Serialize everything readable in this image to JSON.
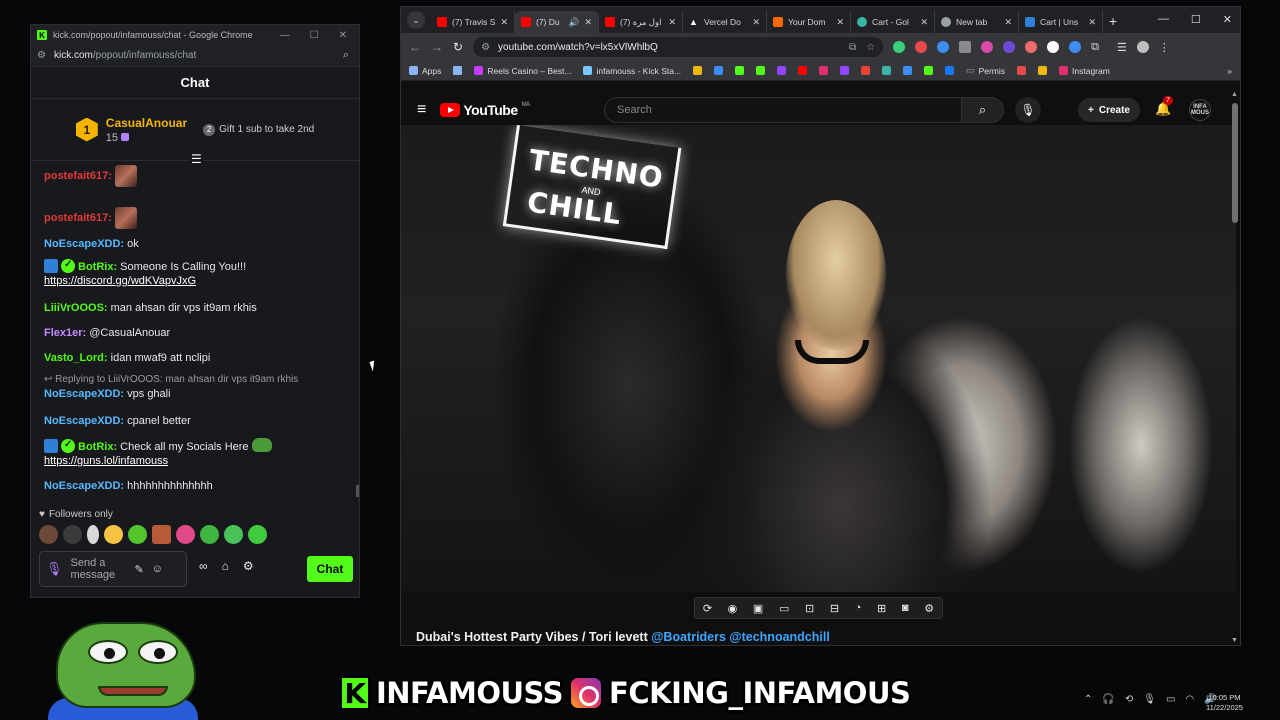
{
  "kick_window": {
    "title": "kick.com/popout/infamouss/chat - Google Chrome",
    "url_host": "kick.com",
    "url_path": "/popout/infamouss/chat",
    "chat_title": "Chat",
    "gift": {
      "rank": "1",
      "user": "CasualAnouar",
      "count": "15",
      "cta_rank": "2",
      "cta": "Gift 1 sub to take 2nd"
    },
    "messages": [
      {
        "user": "postefait617:",
        "color": "#e03a3a",
        "text": ""
      },
      {
        "user": "postefait617:",
        "color": "#e03a3a",
        "text": ""
      },
      {
        "user": "NoEscapeXDD:",
        "color": "#58b8ff",
        "text": "ok"
      },
      {
        "user": "BotRix:",
        "color": "#53fc18",
        "text": "Someone Is Calling You!!!",
        "link": "https://discord.gg/wdKVapvJxG"
      },
      {
        "user": "LiiiVrOOOS:",
        "color": "#53fc18",
        "text": "man ahsan dir vps it9am rkhis"
      },
      {
        "user": "Flex1er:",
        "color": "#c58cff",
        "text": "@CasualAnouar"
      },
      {
        "user": "Vasto_Lord:",
        "color": "#53fc18",
        "text": "idan mwaf9 att nclipi"
      },
      {
        "user": "NoEscapeXDD:",
        "color": "#58b8ff",
        "text": "vps ghali",
        "reply": "Replying to LiiiVrOOOS: man ahsan dir vps it9am rkhis"
      },
      {
        "user": "NoEscapeXDD:",
        "color": "#58b8ff",
        "text": "cpanel better"
      },
      {
        "user": "BotRix:",
        "color": "#53fc18",
        "text": "Check all my Socials Here",
        "link": "https://guns.lol/infamouss"
      },
      {
        "user": "NoEscapeXDD:",
        "color": "#58b8ff",
        "text": "hhhhhhhhhhhhhh"
      }
    ],
    "followers_only": "Followers only",
    "send_placeholder": "Send a message",
    "send_button": "Chat"
  },
  "youtube_window": {
    "tabs": [
      {
        "title": "(7) Travis S",
        "favicon": "#ff0000",
        "active": false
      },
      {
        "title": "(7) Du",
        "favicon": "#ff0000",
        "active": true
      },
      {
        "title": "(7) اول مرة",
        "favicon": "#ff0000",
        "active": false
      },
      {
        "title": "Vercel Do",
        "favicon": "#ffffff",
        "active": false
      },
      {
        "title": "Your Dom",
        "favicon": "#ff6a00",
        "active": false
      },
      {
        "title": "Cart - Gol",
        "favicon": "#3bb4a8",
        "active": false
      },
      {
        "title": "New tab",
        "favicon": "#9aa0a6",
        "active": false
      },
      {
        "title": "Cart | Uns",
        "favicon": "#2f7fd6",
        "active": false
      }
    ],
    "url": "youtube.com/watch?v=lx5xVlWhlbQ",
    "bookmarks": [
      {
        "label": "Apps",
        "color": "#8ab4f8"
      },
      {
        "label": "",
        "color": "#8ab4f8"
      },
      {
        "label": "Reels Casino – Best...",
        "color": "#c83cff"
      },
      {
        "label": "infamouss - Kick Sta...",
        "color": "#7ac7ff"
      },
      {
        "label": "Permis",
        "color": "#9aa0a6"
      },
      {
        "label": "Instagram",
        "color": "#e1306c"
      }
    ],
    "yt": {
      "logo": "YouTube",
      "region": "MA",
      "search_placeholder": "Search",
      "create_label": "Create",
      "notif_count": "7",
      "avatar_text": "INFA MOUS"
    },
    "video": {
      "sign_line1": "TECHNO",
      "sign_line2": "AND",
      "sign_line3": "CHILL",
      "title_main": "Dubai's Hottest Party Vibes / Tori levett",
      "title_tags": "@Boatriders @technoandchill"
    }
  },
  "overlay": {
    "banner_left": "INFAMOUSS",
    "banner_right": "FCKING_INFAMOUS",
    "kick_letter": "K"
  },
  "taskbar": {
    "time": "10:05 PM",
    "date": "11/22/2025"
  }
}
